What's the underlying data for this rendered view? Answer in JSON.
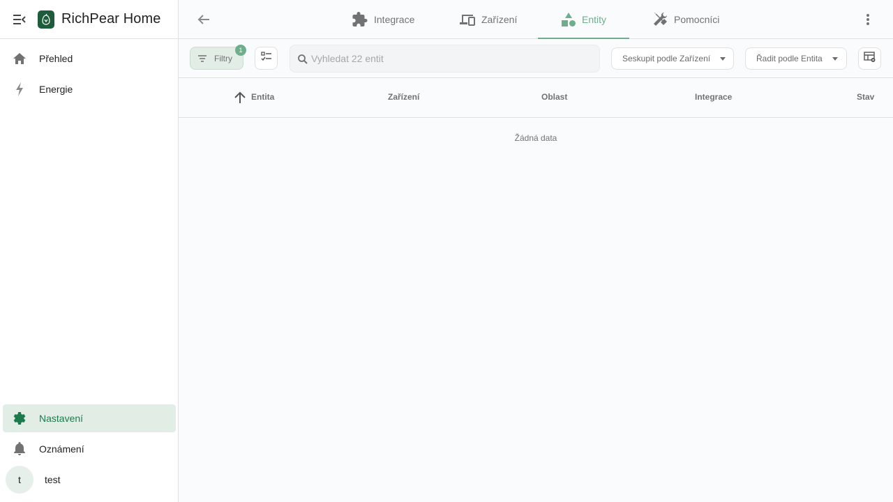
{
  "app": {
    "title": "RichPear Home"
  },
  "sidebar": {
    "items": [
      {
        "label": "Přehled",
        "icon": "home-icon"
      },
      {
        "label": "Energie",
        "icon": "lightning-icon"
      }
    ],
    "bottom_items": [
      {
        "label": "Nastavení",
        "icon": "gear-icon",
        "active": true
      },
      {
        "label": "Oznámení",
        "icon": "bell-icon"
      }
    ],
    "user": {
      "initial": "t",
      "name": "test"
    }
  },
  "tabs": [
    {
      "label": "Integrace",
      "icon": "puzzle-icon"
    },
    {
      "label": "Zařízení",
      "icon": "devices-icon"
    },
    {
      "label": "Entity",
      "icon": "shapes-icon",
      "active": true
    },
    {
      "label": "Pomocníci",
      "icon": "tools-icon"
    }
  ],
  "toolbar": {
    "filters_label": "Filtry",
    "filters_count": "1",
    "search_placeholder": "Vyhledat 22 entit",
    "group_by": "Seskupit podle Zařízení",
    "sort_by": "Řadit podle Entita"
  },
  "table": {
    "columns": [
      "Entita",
      "Zařízení",
      "Oblast",
      "Integrace",
      "Stav"
    ],
    "empty_message": "Žádná data"
  },
  "colors": {
    "accent": "#6fae8d",
    "active_bg": "#e2ede6",
    "active_text": "#1d7a4c",
    "logo_bg": "#1d5d3c"
  }
}
